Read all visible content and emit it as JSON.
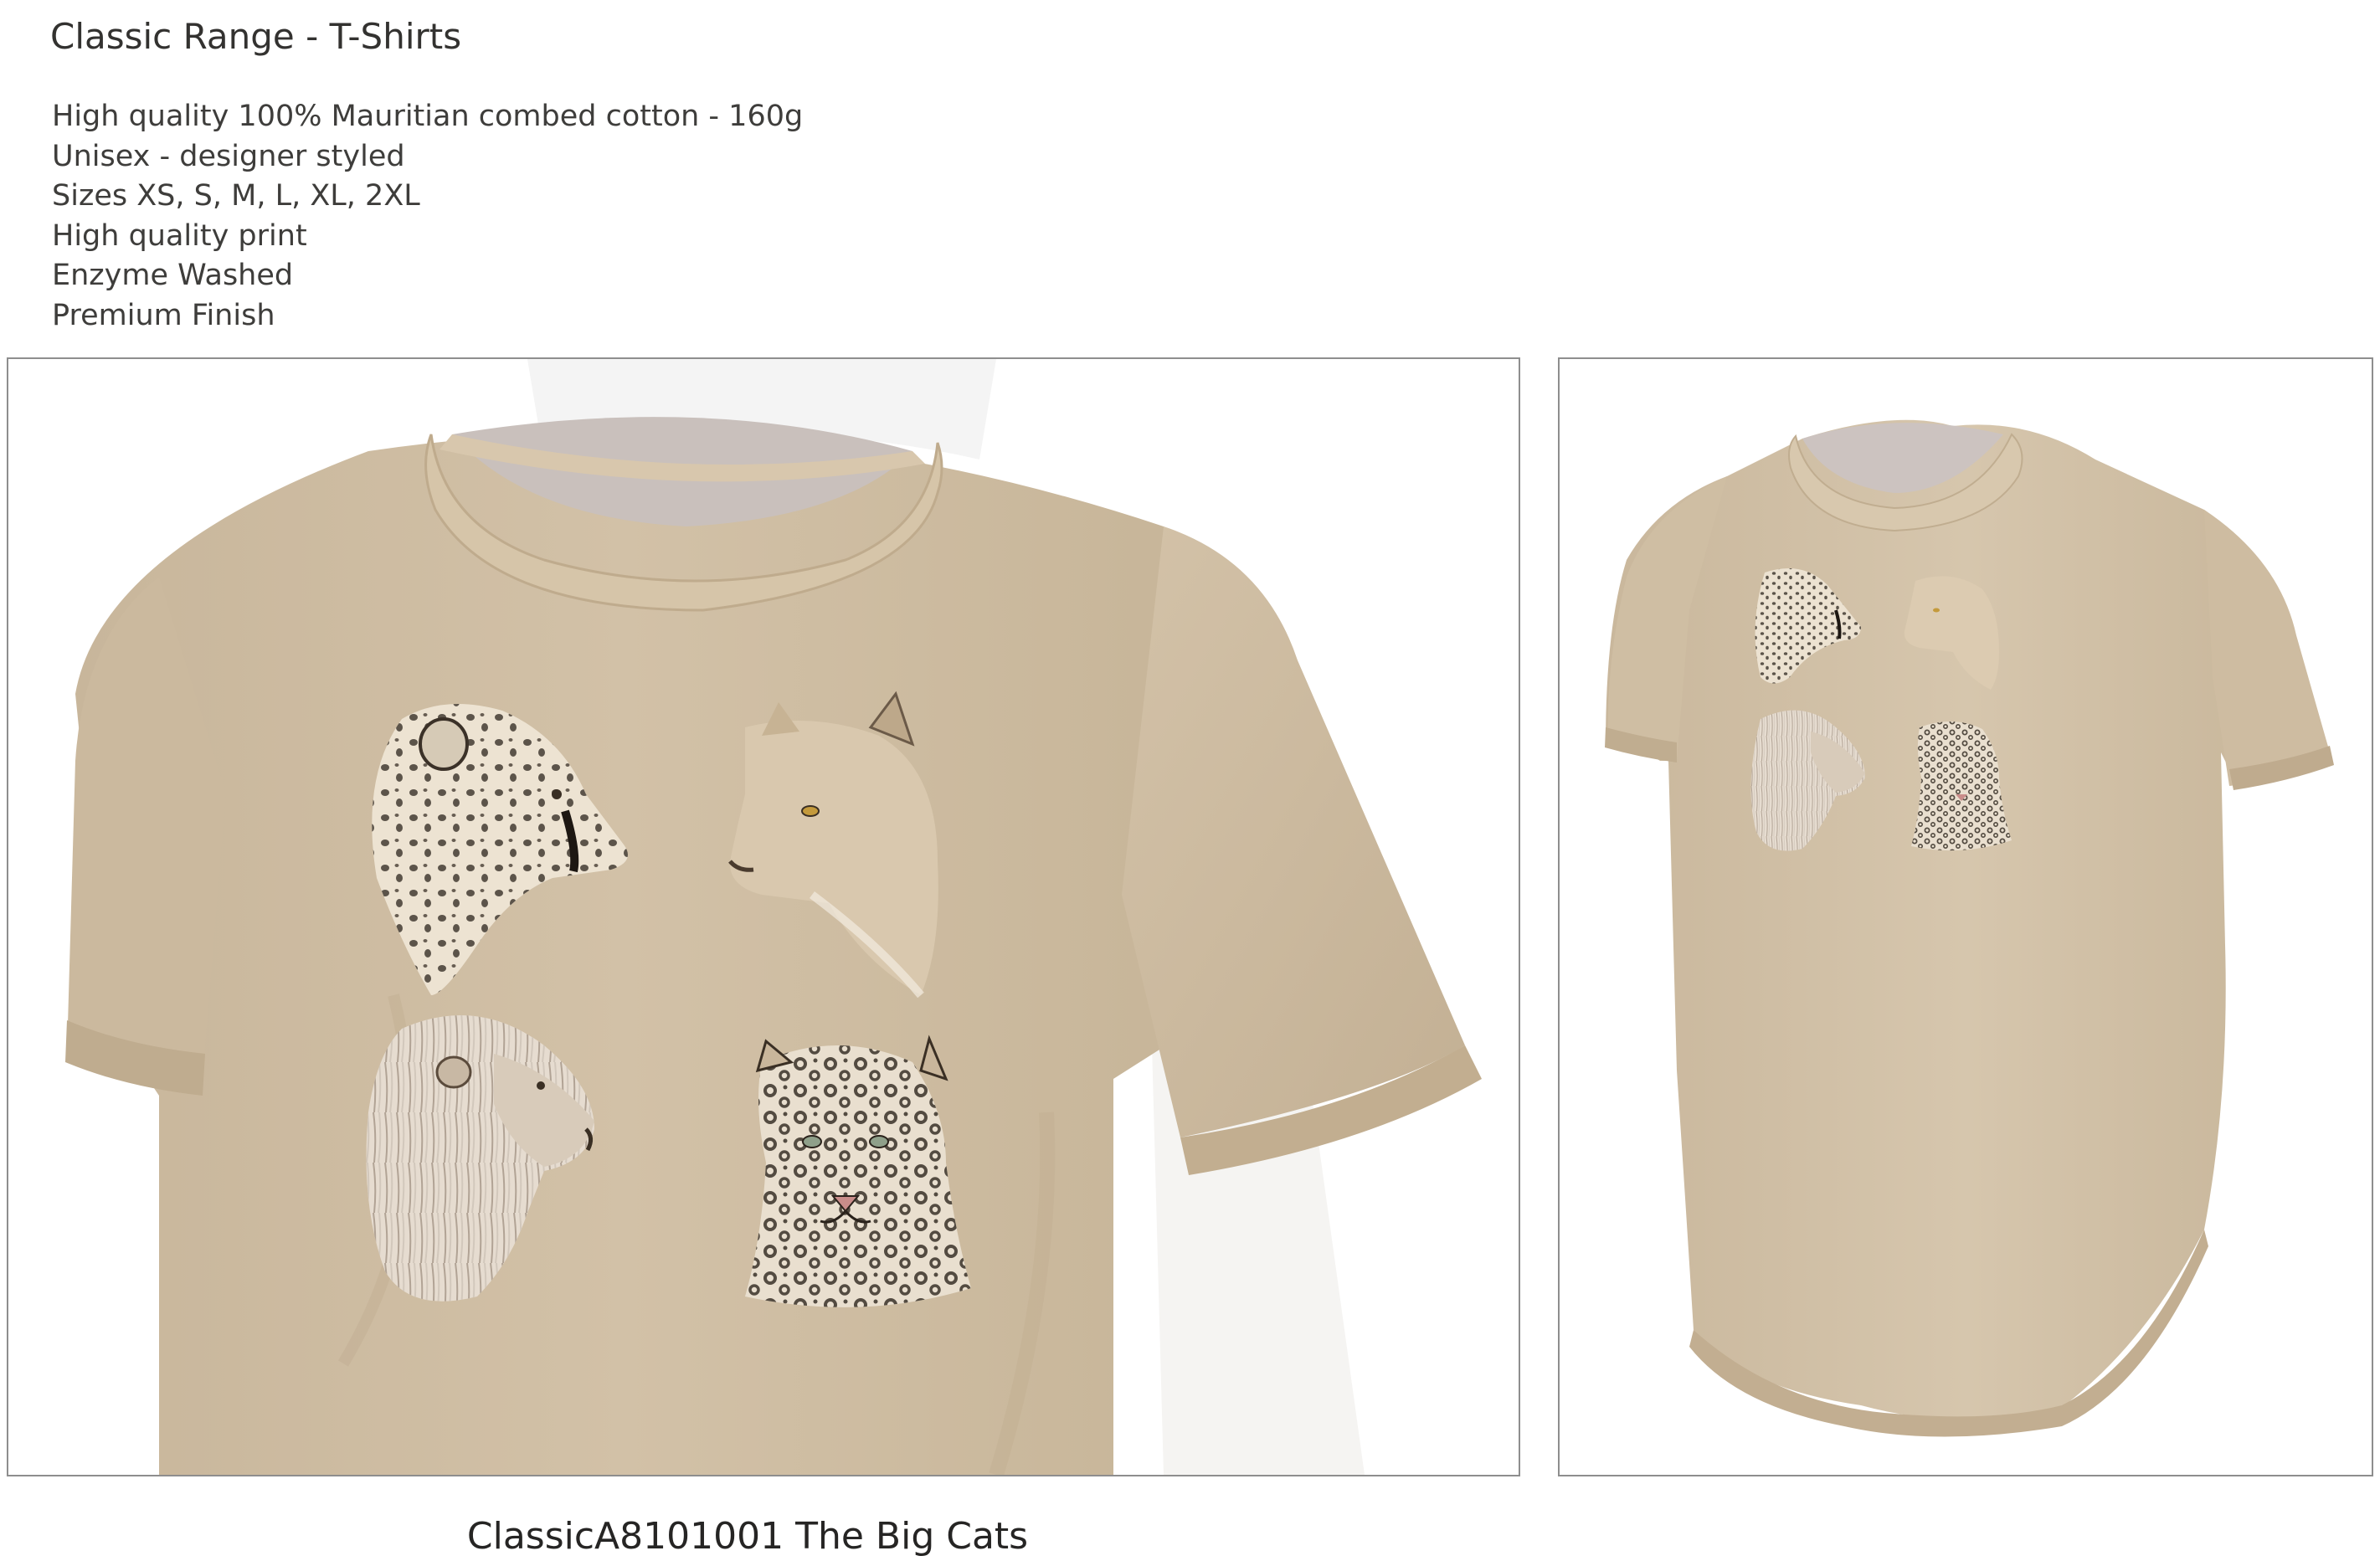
{
  "header": {
    "title": "Classic Range - T-Shirts"
  },
  "features": [
    "High quality 100% Mauritian combed cotton - 160g",
    "Unisex - designer styled",
    "Sizes XS, S, M, L, XL, 2XL",
    "High quality print",
    "Enzyme Washed",
    "Premium Finish"
  ],
  "product": {
    "caption": "ClassicA8101001 The Big Cats",
    "shirt_color": "#cdbba0",
    "print_subjects": [
      "cheetah",
      "lioness",
      "lion",
      "leopard"
    ]
  },
  "colors": {
    "frame_border": "#8e8e8e",
    "text": "#3b3a38"
  }
}
